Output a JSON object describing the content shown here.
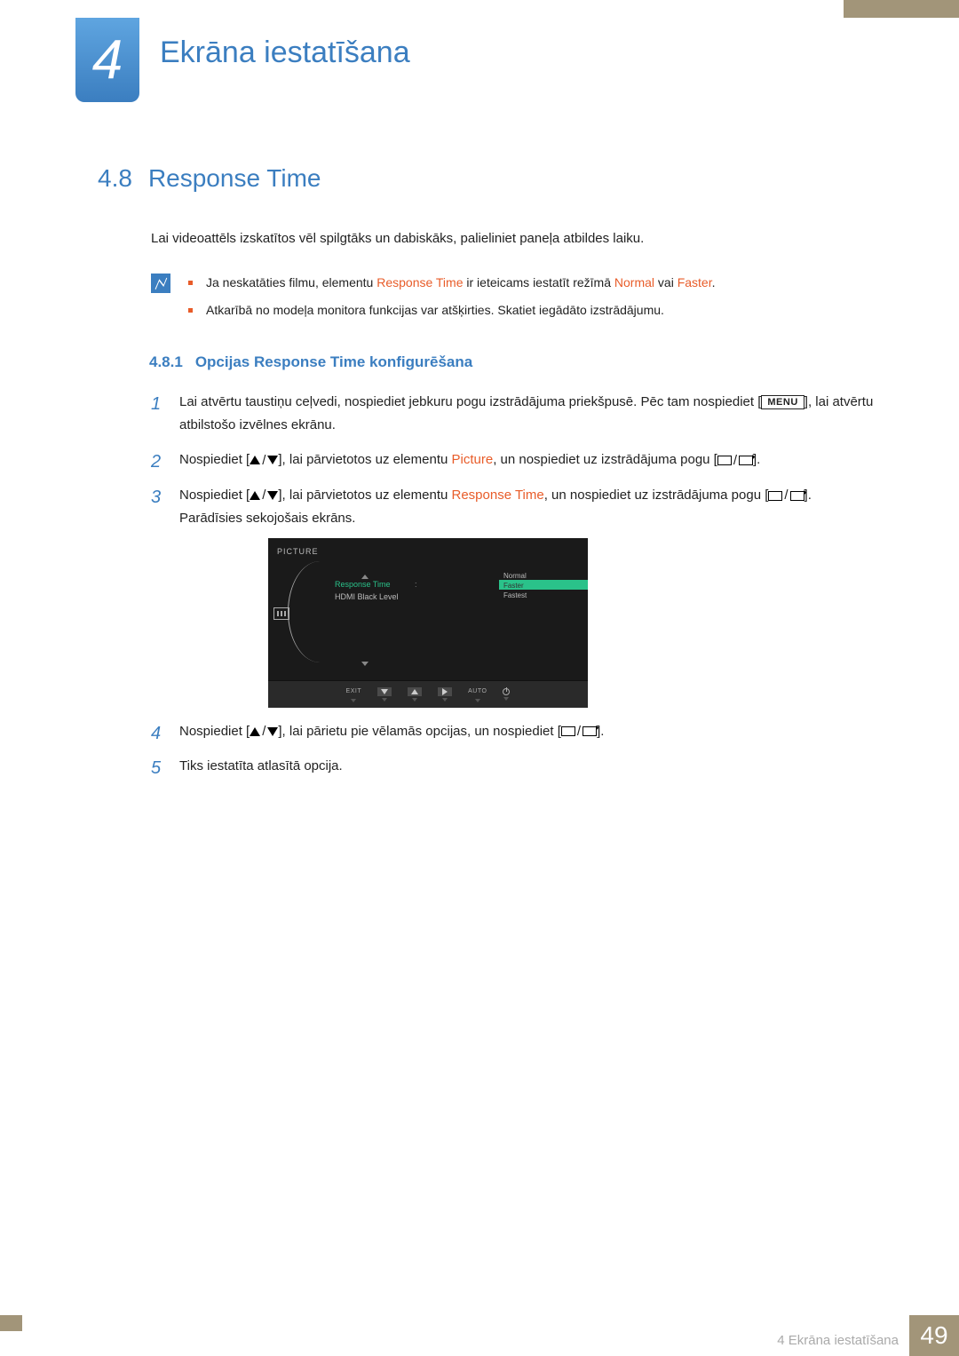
{
  "chapter": {
    "number": "4",
    "title": "Ekrāna iestatīšana"
  },
  "section": {
    "number": "4.8",
    "title": "Response Time"
  },
  "intro": "Lai videoattēls izskatītos vēl spilgtāks un dabiskāks, palieliniet paneļa atbildes laiku.",
  "notes": {
    "line1_pre": "Ja neskatāties filmu, elementu ",
    "line1_em1": "Response Time",
    "line1_mid": " ir ieteicams iestatīt režīmā ",
    "line1_em2": "Normal",
    "line1_mid2": " vai ",
    "line1_em3": "Faster",
    "line1_end": ".",
    "line2": "Atkarībā no modeļa monitora funkcijas var atšķirties. Skatiet iegādāto izstrādājumu."
  },
  "subsection": {
    "number": "4.8.1",
    "title": "Opcijas Response Time konfigurēšana"
  },
  "steps": {
    "s1a": "Lai atvērtu taustiņu ceļvedi, nospiediet jebkuru pogu izstrādājuma priekšpusē. Pēc tam nospiediet [",
    "menu": "MENU",
    "s1b": "], lai atvērtu atbilstošo izvēlnes ekrānu.",
    "s2a": "Nospiediet [",
    "s2b": "], lai pārvietotos uz elementu ",
    "s2_em": "Picture",
    "s2c": ", un nospiediet uz izstrādājuma pogu [",
    "s2d": "].",
    "s3a": "Nospiediet [",
    "s3b": "], lai pārvietotos uz elementu ",
    "s3_em": "Response Time",
    "s3c": ", un nospiediet uz izstrādājuma pogu [",
    "s3d": "]. Parādīsies sekojošais ekrāns.",
    "s4a": "Nospiediet [",
    "s4b": "], lai pārietu pie vēlamās opcijas, un nospiediet [",
    "s4c": "].",
    "s5": "Tiks iestatīta atlasītā opcija."
  },
  "osd": {
    "header": "PICTURE",
    "item_active": "Response Time",
    "item2": "HDMI Black Level",
    "values": [
      "Normal",
      "Faster",
      "Fastest"
    ],
    "selected_index": 1,
    "bottom": [
      "EXIT",
      "",
      "",
      "",
      "AUTO",
      ""
    ]
  },
  "footer": {
    "chapter_label": "4 Ekrāna iestatīšana",
    "page": "49"
  }
}
